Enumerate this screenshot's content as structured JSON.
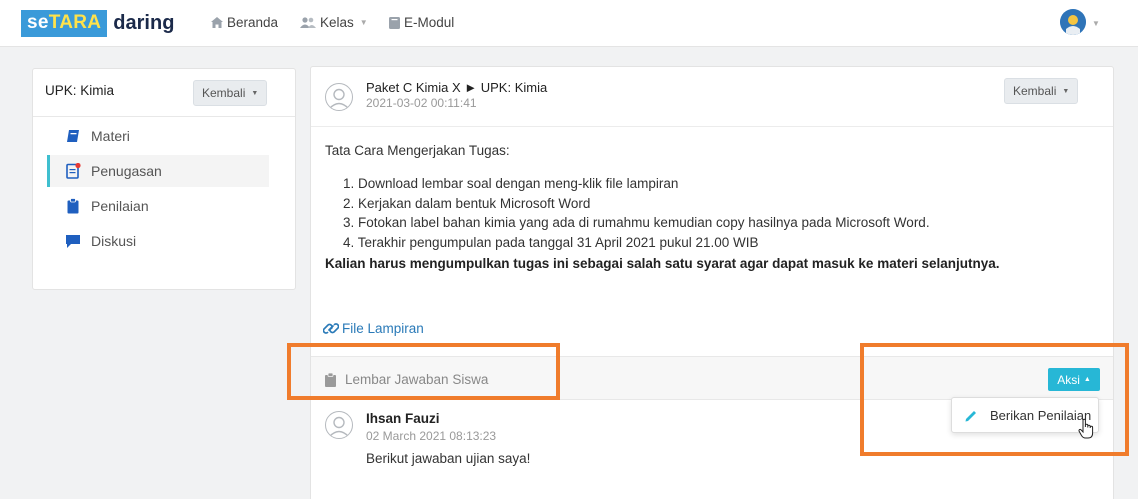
{
  "brand": {
    "part1": "se",
    "part2": "TARA",
    "part3": "daring"
  },
  "nav": {
    "beranda": "Beranda",
    "kelas": "Kelas",
    "emodul": "E-Modul"
  },
  "sidebar": {
    "title": "UPK: Kimia",
    "back_label": "Kembali",
    "items": [
      {
        "label": "Materi",
        "icon": "book-icon"
      },
      {
        "label": "Penugasan",
        "icon": "assignment-icon",
        "active": true
      },
      {
        "label": "Penilaian",
        "icon": "clipboard-icon"
      },
      {
        "label": "Diskusi",
        "icon": "chat-icon"
      }
    ]
  },
  "post": {
    "title": "Paket C Kimia X ► UPK: Kimia",
    "date": "2021-03-02 00:11:41",
    "back_label": "Kembali",
    "lead": "Tata Cara Mengerjakan Tugas:",
    "steps": [
      "1. Download lembar soal dengan meng-klik file lampiran",
      "2. Kerjakan dalam bentuk Microsoft Word",
      "3. Fotokan label bahan kimia yang ada di rumahmu kemudian copy hasilnya pada Microsoft Word.",
      "4. Terakhir pengumpulan pada tanggal 31 April 2021 pukul 21.00 WIB"
    ],
    "bold_note": "Kalian harus mengumpulkan tugas ini sebagai salah satu syarat agar dapat masuk ke materi selanjutnya.",
    "attachment_label": "File Lampiran"
  },
  "answers": {
    "header": "Lembar Jawaban Siswa",
    "action_label": "Aksi",
    "dropdown_item": "Berikan Penilaian",
    "reply": {
      "name": "Ihsan Fauzi",
      "date": "02 March 2021 08:13:23",
      "text": "Berikut jawaban ujian saya!"
    }
  },
  "colors": {
    "accent": "#27b7d6",
    "brand_blue": "#3a9ad9",
    "highlight": "#f07c2c",
    "link": "#2a7ab8"
  }
}
